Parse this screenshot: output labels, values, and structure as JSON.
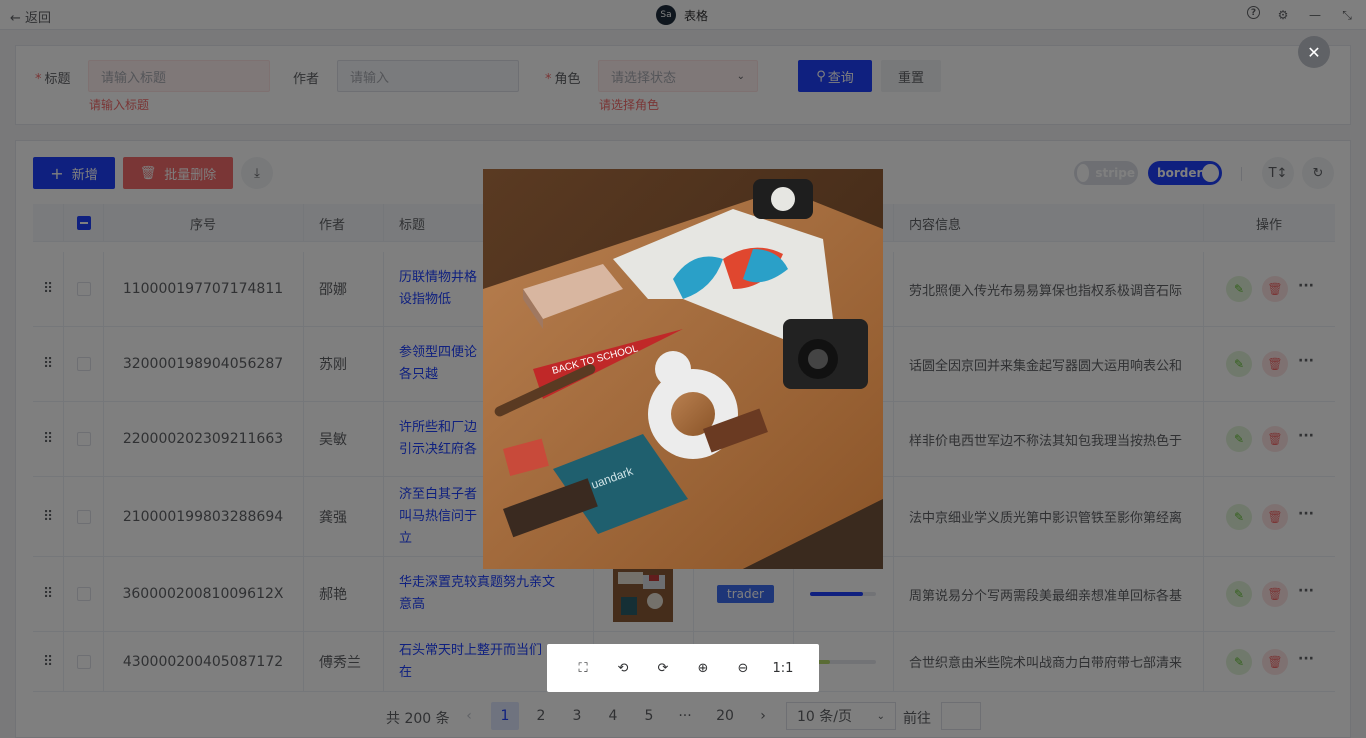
{
  "topbar": {
    "back_label": "← 返回",
    "logo_text": "Sa",
    "title": "表格",
    "icons": [
      "help-icon",
      "settings-icon",
      "minimize-icon",
      "collapse-icon"
    ]
  },
  "search": {
    "title_label": "标题",
    "title_placeholder": "请输入标题",
    "title_error": "请输入标题",
    "author_label": "作者",
    "author_placeholder": "请输入",
    "role_label": "角色",
    "role_placeholder": "请选择状态",
    "role_error": "请选择角色",
    "query_label": "查询",
    "reset_label": "重置"
  },
  "toolbar": {
    "add_label": "新增",
    "batch_delete_label": "批量删除",
    "stripe_label": "stripe",
    "border_label": "border"
  },
  "table": {
    "headers": {
      "index": "序号",
      "author": "作者",
      "title": "标题",
      "content": "内容信息",
      "actions": "操作"
    },
    "rows": [
      {
        "id": "110000197707174811",
        "author": "邵娜",
        "title1": "历联情物井格",
        "title2": "设指物低",
        "content": "劳北照便入传光布易易算保也指权系极调音石际"
      },
      {
        "id": "320000198904056287",
        "author": "苏刚",
        "title1": "参领型四便论",
        "title2": "各只越",
        "content": "话圆全因京回并来集金起写器圆大运用响表公和"
      },
      {
        "id": "220000202309211663",
        "author": "吴敏",
        "title1": "许所些和厂边",
        "title2": "引示决红府各",
        "content": "样非价电西世军边不称法其知包我理当按热色于"
      },
      {
        "id": "210000199803288694",
        "author": "龚强",
        "title1": "济至白其子者",
        "title2": "叫马热信问于",
        "title3": "立",
        "content": "法中京细业学义质光第中影识管铁至影你第经离"
      },
      {
        "id": "36000020081009612X",
        "author": "郝艳",
        "title1": "华走深置克较真题努九亲文",
        "title2": "意高",
        "role": "trader",
        "progress": 0.8,
        "content": "周第说易分个写两需段美最细亲想准单回标各基"
      },
      {
        "id": "430000200405087172",
        "author": "傅秀兰",
        "title1": "石头常天时上整开而当们",
        "title2": "在",
        "progress": 0.3,
        "content": "合世织意由米些院术叫战商力白带府带七部清来"
      }
    ]
  },
  "pagination": {
    "total": "共 200 条",
    "pages": [
      "1",
      "2",
      "3",
      "4",
      "5",
      "···",
      "20"
    ],
    "active": "1",
    "page_size": "10 条/页",
    "goto_label": "前往"
  },
  "viewer": {
    "close_icon": "close-icon",
    "tools": [
      "fullscreen-icon",
      "rotate-left-icon",
      "rotate-right-icon",
      "zoom-in-icon",
      "zoom-out-icon"
    ],
    "one_to_one_label": "1:1",
    "image_text": {
      "pennant": "BACK TO SCHOOL",
      "notebook": "uandark"
    }
  },
  "colors": {
    "primary": "#1e40ff",
    "danger": "#f56c6c",
    "success": "#67c23a",
    "mask": "rgba(0,0,0,0.5)"
  }
}
